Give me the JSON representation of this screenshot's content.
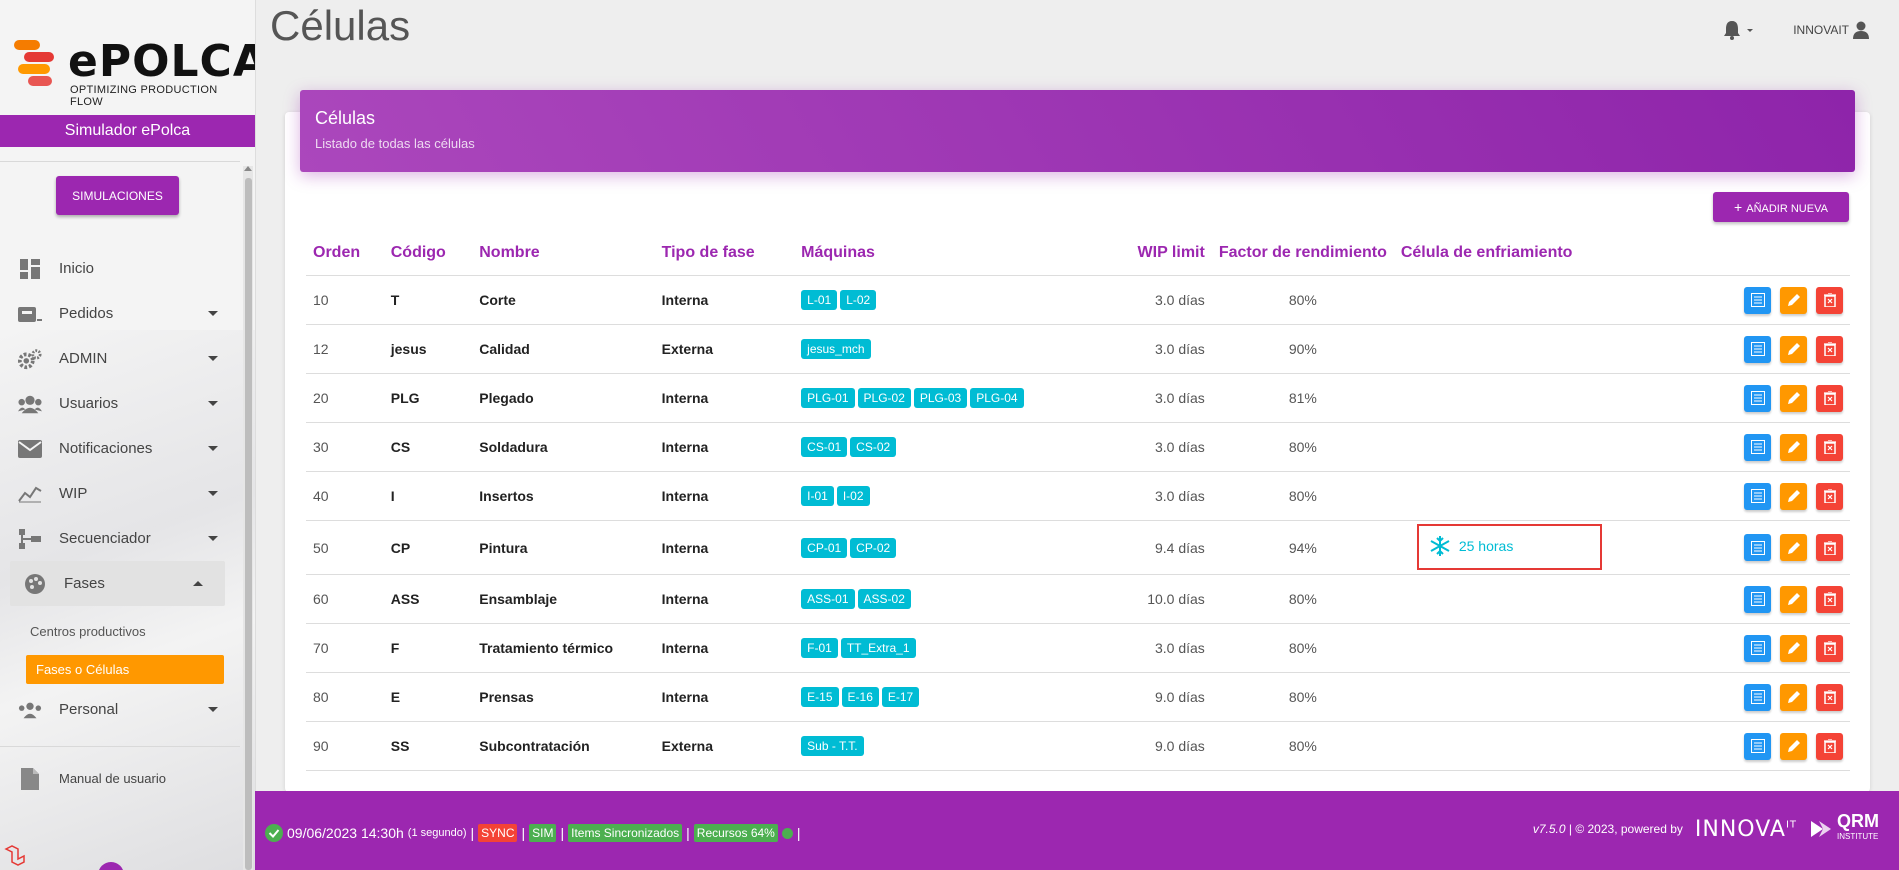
{
  "app": {
    "logo_text": "ePOLCA",
    "logo_tagline": "OPTIMIZING PRODUCTION FLOW",
    "simulator_label": "Simulador ePolca",
    "simulations_button": "SIMULACIONES"
  },
  "sidebar": {
    "items": [
      {
        "label": "Inicio",
        "icon": "dashboard-icon",
        "has_caret": false
      },
      {
        "label": "Pedidos",
        "icon": "orders-icon",
        "has_caret": true
      },
      {
        "label": "ADMIN",
        "icon": "gears-icon",
        "has_caret": true
      },
      {
        "label": "Usuarios",
        "icon": "users-icon",
        "has_caret": true
      },
      {
        "label": "Notificaciones",
        "icon": "envelope-icon",
        "has_caret": true
      },
      {
        "label": "WIP",
        "icon": "chart-line-icon",
        "has_caret": true
      },
      {
        "label": "Secuenciador",
        "icon": "sitemap-icon",
        "has_caret": true
      },
      {
        "label": "Fases",
        "icon": "palette-icon",
        "has_caret": true,
        "open": true
      }
    ],
    "sub_items": {
      "centros": "Centros productivos",
      "fases_celulas": "Fases o Células"
    },
    "personal": "Personal",
    "manual": "Manual de usuario"
  },
  "header": {
    "page_title": "Células",
    "user": "INNOVAIT"
  },
  "card": {
    "title": "Células",
    "subtitle": "Listado de todas las células",
    "add_button": "AÑADIR NUEVA"
  },
  "table": {
    "columns": [
      "Orden",
      "Código",
      "Nombre",
      "Tipo de fase",
      "Máquinas",
      "WIP limit",
      "Factor de rendimiento",
      "Célula de enfriamiento"
    ],
    "rows": [
      {
        "orden": "10",
        "codigo": "T",
        "nombre": "Corte",
        "tipo": "Interna",
        "maquinas": [
          "L-01",
          "L-02"
        ],
        "wip": "3.0 días",
        "factor": "80%",
        "enfriamiento": ""
      },
      {
        "orden": "12",
        "codigo": "jesus",
        "nombre": "Calidad",
        "tipo": "Externa",
        "maquinas": [
          "jesus_mch"
        ],
        "wip": "3.0 días",
        "factor": "90%",
        "enfriamiento": ""
      },
      {
        "orden": "20",
        "codigo": "PLG",
        "nombre": "Plegado",
        "tipo": "Interna",
        "maquinas": [
          "PLG-01",
          "PLG-02",
          "PLG-03",
          "PLG-04"
        ],
        "wip": "3.0 días",
        "factor": "81%",
        "enfriamiento": ""
      },
      {
        "orden": "30",
        "codigo": "CS",
        "nombre": "Soldadura",
        "tipo": "Interna",
        "maquinas": [
          "CS-01",
          "CS-02"
        ],
        "wip": "3.0 días",
        "factor": "80%",
        "enfriamiento": ""
      },
      {
        "orden": "40",
        "codigo": "I",
        "nombre": "Insertos",
        "tipo": "Interna",
        "maquinas": [
          "I-01",
          "I-02"
        ],
        "wip": "3.0 días",
        "factor": "80%",
        "enfriamiento": ""
      },
      {
        "orden": "50",
        "codigo": "CP",
        "nombre": "Pintura",
        "tipo": "Interna",
        "maquinas": [
          "CP-01",
          "CP-02"
        ],
        "wip": "9.4 días",
        "factor": "94%",
        "enfriamiento": "25 horas"
      },
      {
        "orden": "60",
        "codigo": "ASS",
        "nombre": "Ensamblaje",
        "tipo": "Interna",
        "maquinas": [
          "ASS-01",
          "ASS-02"
        ],
        "wip": "10.0 días",
        "factor": "80%",
        "enfriamiento": ""
      },
      {
        "orden": "70",
        "codigo": "F",
        "nombre": "Tratamiento térmico",
        "tipo": "Interna",
        "maquinas": [
          "F-01",
          "TT_Extra_1"
        ],
        "wip": "3.0 días",
        "factor": "80%",
        "enfriamiento": ""
      },
      {
        "orden": "80",
        "codigo": "E",
        "nombre": "Prensas",
        "tipo": "Interna",
        "maquinas": [
          "E-15",
          "E-16",
          "E-17"
        ],
        "wip": "9.0 días",
        "factor": "80%",
        "enfriamiento": ""
      },
      {
        "orden": "90",
        "codigo": "SS",
        "nombre": "Subcontratación",
        "tipo": "Externa",
        "maquinas": [
          "Sub - T.T."
        ],
        "wip": "9.0 días",
        "factor": "80%",
        "enfriamiento": ""
      }
    ]
  },
  "footer": {
    "datetime": "09/06/2023 14:30h",
    "elapsed": "(1 segundo)",
    "sep": "|",
    "sync": "SYNC",
    "sim": "SIM",
    "items": "Items Sincronizados",
    "recursos": "Recursos 64%",
    "version": "v7.5.0",
    "copyright": "| © 2023, powered by",
    "innova": "INNOVA",
    "innova_sup": "IT",
    "qrm": "QRM",
    "qrm_sub": "INSTITUTE"
  },
  "colors": {
    "primary": "#9c27b0",
    "accent_orange": "#ff9800",
    "badge_cyan": "#00bcd4",
    "view_blue": "#2196f3",
    "delete_red": "#f44336",
    "ok_green": "#4caf50"
  }
}
